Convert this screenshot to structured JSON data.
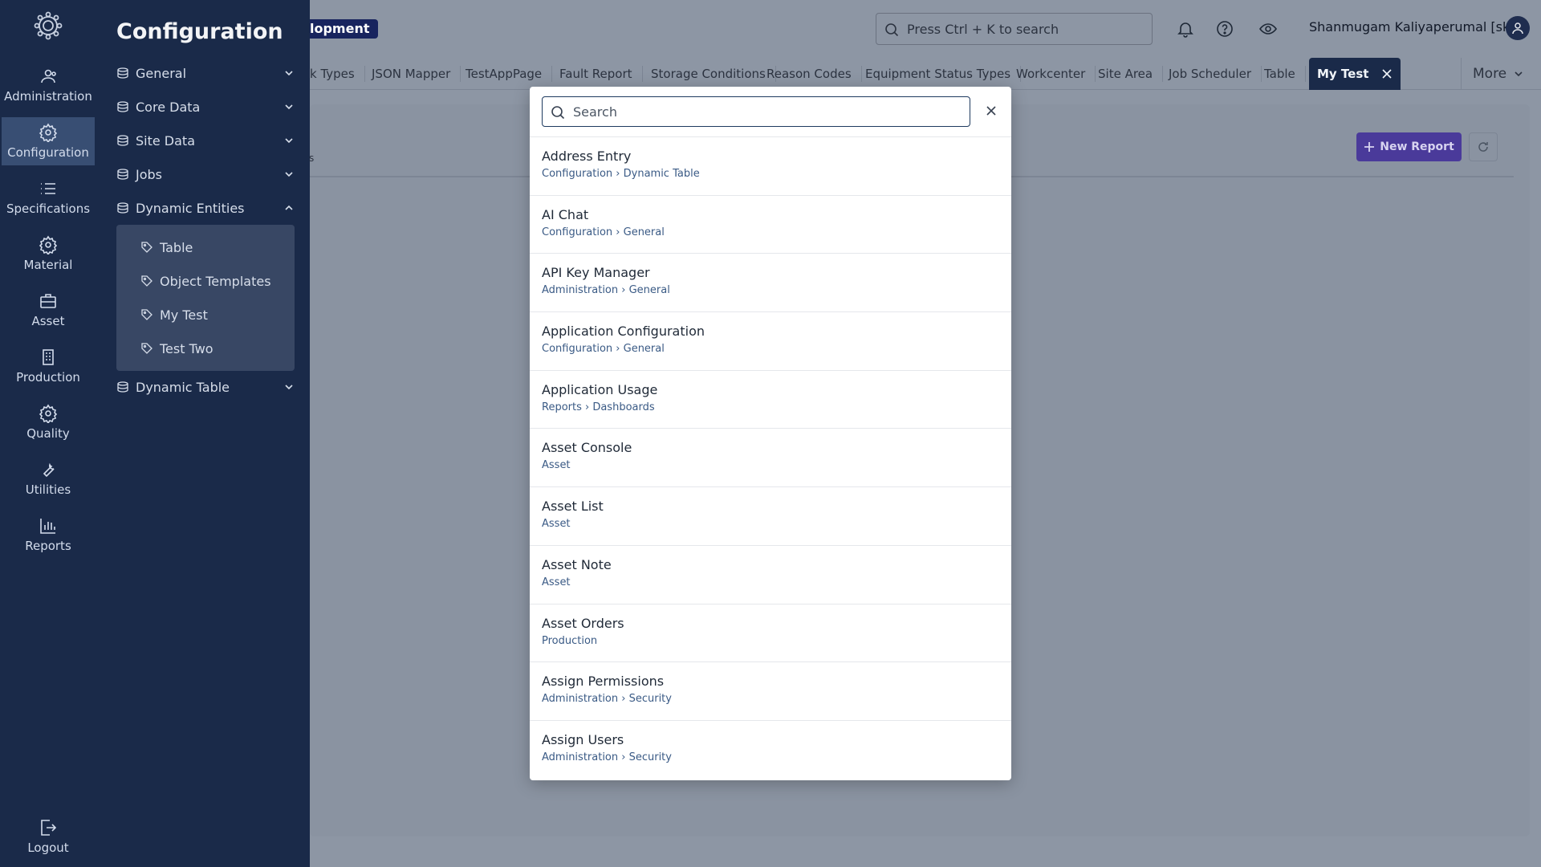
{
  "rail": {
    "items": [
      {
        "label": "Administration",
        "icon": "users-icon"
      },
      {
        "label": "Configuration",
        "icon": "gear-icon"
      },
      {
        "label": "Specifications",
        "icon": "list-icon"
      },
      {
        "label": "Material",
        "icon": "gear-icon"
      },
      {
        "label": "Asset",
        "icon": "briefcase-icon"
      },
      {
        "label": "Production",
        "icon": "building-icon"
      },
      {
        "label": "Quality",
        "icon": "gear-icon"
      },
      {
        "label": "Utilities",
        "icon": "wrench-icon"
      },
      {
        "label": "Reports",
        "icon": "bar-chart-icon"
      }
    ],
    "logout": "Logout"
  },
  "subnav": {
    "title": "Configuration",
    "items": [
      "General",
      "Core Data",
      "Site Data",
      "Jobs",
      "Dynamic Entities"
    ],
    "children": [
      "Table",
      "Object Templates",
      "My Test",
      "Test Two"
    ],
    "last": "Dynamic Table"
  },
  "header": {
    "env_badge": "lopment",
    "search_placeholder": "Press Ctrl + K to search",
    "user": "Shanmugam Kaliyaperumal [sk]"
  },
  "tabs": {
    "items": [
      "k Types",
      "JSON Mapper",
      "TestAppPage",
      "Fault Report",
      "Storage Conditions",
      "Reason Codes",
      "Equipment Status Types",
      "Workcenter",
      "Site Area",
      "Job Scheduler",
      "Table"
    ],
    "active": "My Test",
    "more": "More"
  },
  "content": {
    "new_report": "New Report",
    "fragment": "s"
  },
  "modal": {
    "search_placeholder": "Search",
    "results": [
      {
        "title": "Address Entry",
        "path": "Configuration › Dynamic Table"
      },
      {
        "title": "AI Chat",
        "path": "Configuration › General"
      },
      {
        "title": "API Key Manager",
        "path": "Administration › General"
      },
      {
        "title": "Application Configuration",
        "path": "Configuration › General"
      },
      {
        "title": "Application Usage",
        "path": "Reports › Dashboards"
      },
      {
        "title": "Asset Console",
        "path": "Asset"
      },
      {
        "title": "Asset List",
        "path": "Asset"
      },
      {
        "title": "Asset Note",
        "path": "Asset"
      },
      {
        "title": "Asset Orders",
        "path": "Production"
      },
      {
        "title": "Assign Permissions",
        "path": "Administration › Security"
      },
      {
        "title": "Assign Users",
        "path": "Administration › Security"
      }
    ]
  }
}
